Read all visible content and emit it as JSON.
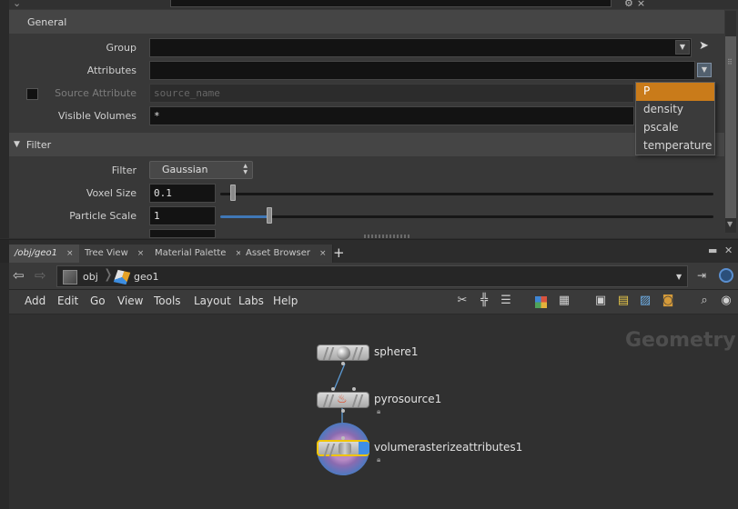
{
  "param_pane": {
    "general_header": "General",
    "group_label": "Group",
    "group_value": "",
    "attributes_label": "Attributes",
    "attributes_value": "",
    "source_attribute_label": "Source Attribute",
    "source_attribute_placeholder": "source_name",
    "visible_volumes_label": "Visible Volumes",
    "visible_volumes_value": "*",
    "filter_header": "Filter",
    "filter_label": "Filter",
    "filter_value": "Gaussian",
    "voxel_size_label": "Voxel Size",
    "voxel_size_value": "0.1",
    "voxel_size_slider_fraction": 0.02,
    "particle_scale_label": "Particle Scale",
    "particle_scale_value": "1",
    "particle_scale_slider_fraction": 0.1,
    "attributes_dropdown": {
      "options": [
        "P",
        "density",
        "pscale",
        "temperature"
      ],
      "highlighted": "P",
      "highlight_color": "#c97b1a"
    }
  },
  "pane_tabs": [
    {
      "label": "/obj/geo1",
      "active": true
    },
    {
      "label": "Tree View",
      "active": false
    },
    {
      "label": "Material Palette",
      "active": false
    },
    {
      "label": "Asset Browser",
      "active": false
    }
  ],
  "tab_close_glyph": "×",
  "tab_add_glyph": "+",
  "path_bar": {
    "crumbs": [
      {
        "label": "obj",
        "icon": "obj-network-icon"
      },
      {
        "label": "geo1",
        "icon": "geometry-object-icon"
      }
    ]
  },
  "network_menu": [
    "Add",
    "Edit",
    "Go",
    "View",
    "Tools",
    "Layout",
    "Labs",
    "Help"
  ],
  "network_editor": {
    "context_label": "Geometry",
    "nodes": [
      {
        "name": "sphere1",
        "icon": "sphere-icon"
      },
      {
        "name": "pyrosource1",
        "icon": "flame-icon"
      },
      {
        "name": "volumerasterizeattributes1",
        "icon": "volume-rasterize-icon",
        "selected": true,
        "display_flag": true
      }
    ],
    "accent_color": "#3f8ee6",
    "selection_color": "#f0c400"
  }
}
